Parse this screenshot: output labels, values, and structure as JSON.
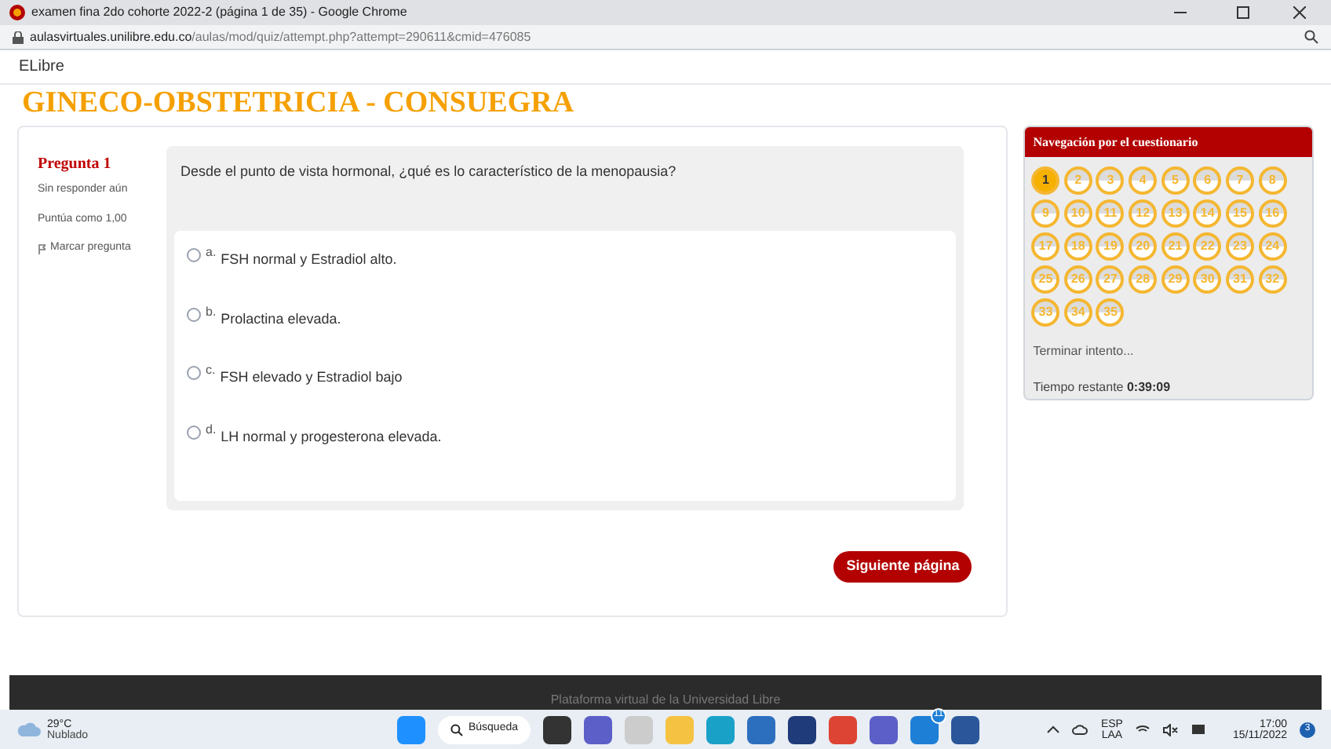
{
  "browser": {
    "tab_title": "examen fina 2do cohorte 2022-2 (página 1 de 35) - Google Chrome",
    "url_domain": "aulasvirtuales.unilibre.edu.co",
    "url_path": "/aulas/mod/quiz/attempt.php?attempt=290611&cmid=476085"
  },
  "site": {
    "brand": "ELibre",
    "course_title": "GINECO-OBSTETRICIA - CONSUEGRA"
  },
  "question": {
    "title": "Pregunta 1",
    "status": "Sin responder aún",
    "grade": "Puntúa como 1,00",
    "flag_label": "Marcar pregunta",
    "text": "Desde el punto de vista hormonal, ¿qué es lo característico de la menopausia?",
    "options": [
      {
        "letter": "a.",
        "text": "FSH normal y Estradiol alto.",
        "selected": false
      },
      {
        "letter": "b.",
        "text": "Prolactina elevada.",
        "selected": false
      },
      {
        "letter": "c.",
        "text": "FSH elevado y Estradiol bajo",
        "selected": false
      },
      {
        "letter": "d.",
        "text": "LH normal y progesterona elevada.",
        "selected": false
      }
    ]
  },
  "next_button": "Siguiente página",
  "navigation": {
    "title": "Navegación por el cuestionario",
    "items": [
      {
        "label": "1",
        "selected": true
      },
      {
        "label": "2",
        "selected": false
      },
      {
        "label": "3",
        "selected": false
      },
      {
        "label": "4",
        "selected": false
      },
      {
        "label": "5",
        "selected": false
      },
      {
        "label": "6",
        "selected": false
      },
      {
        "label": "7",
        "selected": false
      },
      {
        "label": "8",
        "selected": false
      },
      {
        "label": "9",
        "selected": false
      },
      {
        "label": "10",
        "selected": false
      },
      {
        "label": "11",
        "selected": false
      },
      {
        "label": "12",
        "selected": false
      },
      {
        "label": "13",
        "selected": false
      },
      {
        "label": "14",
        "selected": false
      },
      {
        "label": "15",
        "selected": false
      },
      {
        "label": "16",
        "selected": false
      },
      {
        "label": "17",
        "selected": false
      },
      {
        "label": "18",
        "selected": false
      },
      {
        "label": "19",
        "selected": false
      },
      {
        "label": "20",
        "selected": false
      },
      {
        "label": "21",
        "selected": false
      },
      {
        "label": "22",
        "selected": false
      },
      {
        "label": "23",
        "selected": false
      },
      {
        "label": "24",
        "selected": false
      },
      {
        "label": "25",
        "selected": false
      },
      {
        "label": "26",
        "selected": false
      },
      {
        "label": "27",
        "selected": false
      },
      {
        "label": "28",
        "selected": false
      },
      {
        "label": "29",
        "selected": false
      },
      {
        "label": "30",
        "selected": false
      },
      {
        "label": "31",
        "selected": false
      },
      {
        "label": "32",
        "selected": false
      },
      {
        "label": "33",
        "selected": false
      },
      {
        "label": "34",
        "selected": false
      },
      {
        "label": "35",
        "selected": false
      }
    ],
    "finish_link": "Terminar intento...",
    "time_label": "Tiempo restante",
    "time_value": "0:39:09"
  },
  "footer": "Plataforma virtual de la Universidad Libre",
  "taskbar": {
    "temperature": "29°C",
    "weather": "Nublado",
    "search": "Búsqueda",
    "mail_badge": "11",
    "lang": "ESP",
    "layout": "LAA",
    "time": "17:00",
    "date": "15/11/2022",
    "notifications": "3"
  }
}
